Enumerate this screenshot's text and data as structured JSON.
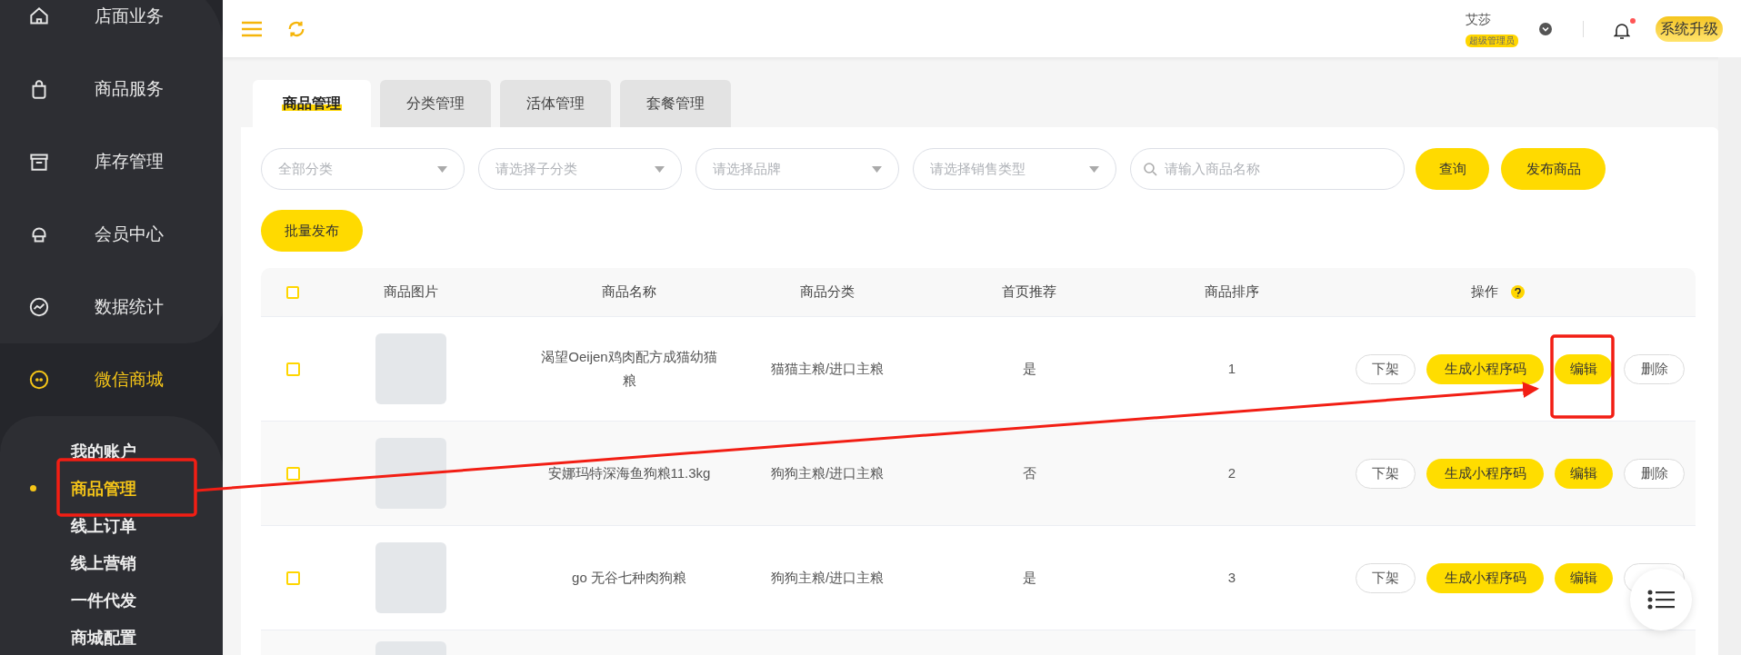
{
  "sidebar": {
    "items": [
      {
        "label": "店面业务",
        "selected": false
      },
      {
        "label": "商品服务",
        "selected": false
      },
      {
        "label": "库存管理",
        "selected": false
      },
      {
        "label": "会员中心",
        "selected": false
      },
      {
        "label": "数据统计",
        "selected": false
      },
      {
        "label": "微信商城",
        "selected": true,
        "children": [
          {
            "label": "我的账户",
            "selected": false
          },
          {
            "label": "商品管理",
            "selected": true
          },
          {
            "label": "线上订单",
            "selected": false
          },
          {
            "label": "线上营销",
            "selected": false
          },
          {
            "label": "一件代发",
            "selected": false
          },
          {
            "label": "商城配置",
            "selected": false
          }
        ]
      }
    ]
  },
  "header": {
    "user_name": "艾莎",
    "role_badge": "超级管理员",
    "notification_unread": true,
    "upgrade_button": "系统升级"
  },
  "tabs": [
    {
      "label": "商品管理",
      "selected": true
    },
    {
      "label": "分类管理",
      "selected": false
    },
    {
      "label": "活体管理",
      "selected": false
    },
    {
      "label": "套餐管理",
      "selected": false
    }
  ],
  "filters": {
    "selects": [
      {
        "placeholder": "全部分类"
      },
      {
        "placeholder": "请选择子分类"
      },
      {
        "placeholder": "请选择品牌"
      },
      {
        "placeholder": "请选择销售类型"
      }
    ],
    "search": {
      "placeholder": "请输入商品名称"
    },
    "buttons": [
      "查询",
      "发布商品",
      "批量发布"
    ]
  },
  "table": {
    "columns": [
      "商品图片",
      "商品名称",
      "商品分类",
      "首页推荐",
      "商品排序",
      "操作"
    ],
    "header_checked": false,
    "rows": [
      {
        "checked": false,
        "name": "渴望Oeijen鸡肉配方成猫幼猫粮",
        "category": "猫猫主粮/进口主粮",
        "recommended": "是",
        "sort": "1",
        "actions": [
          "下架",
          "生成小程序码",
          "编辑",
          "删除"
        ]
      },
      {
        "checked": false,
        "name": "安娜玛特深海鱼狗粮11.3kg",
        "category": "狗狗主粮/进口主粮",
        "recommended": "否",
        "sort": "2",
        "actions": [
          "下架",
          "生成小程序码",
          "编辑",
          "删除"
        ]
      },
      {
        "checked": false,
        "name": "go 无谷七种肉狗粮",
        "category": "狗狗主粮/进口主粮",
        "recommended": "是",
        "sort": "3",
        "actions": [
          "下架",
          "生成小程序码",
          "编辑"
        ]
      },
      {
        "image_only": true
      }
    ]
  }
}
